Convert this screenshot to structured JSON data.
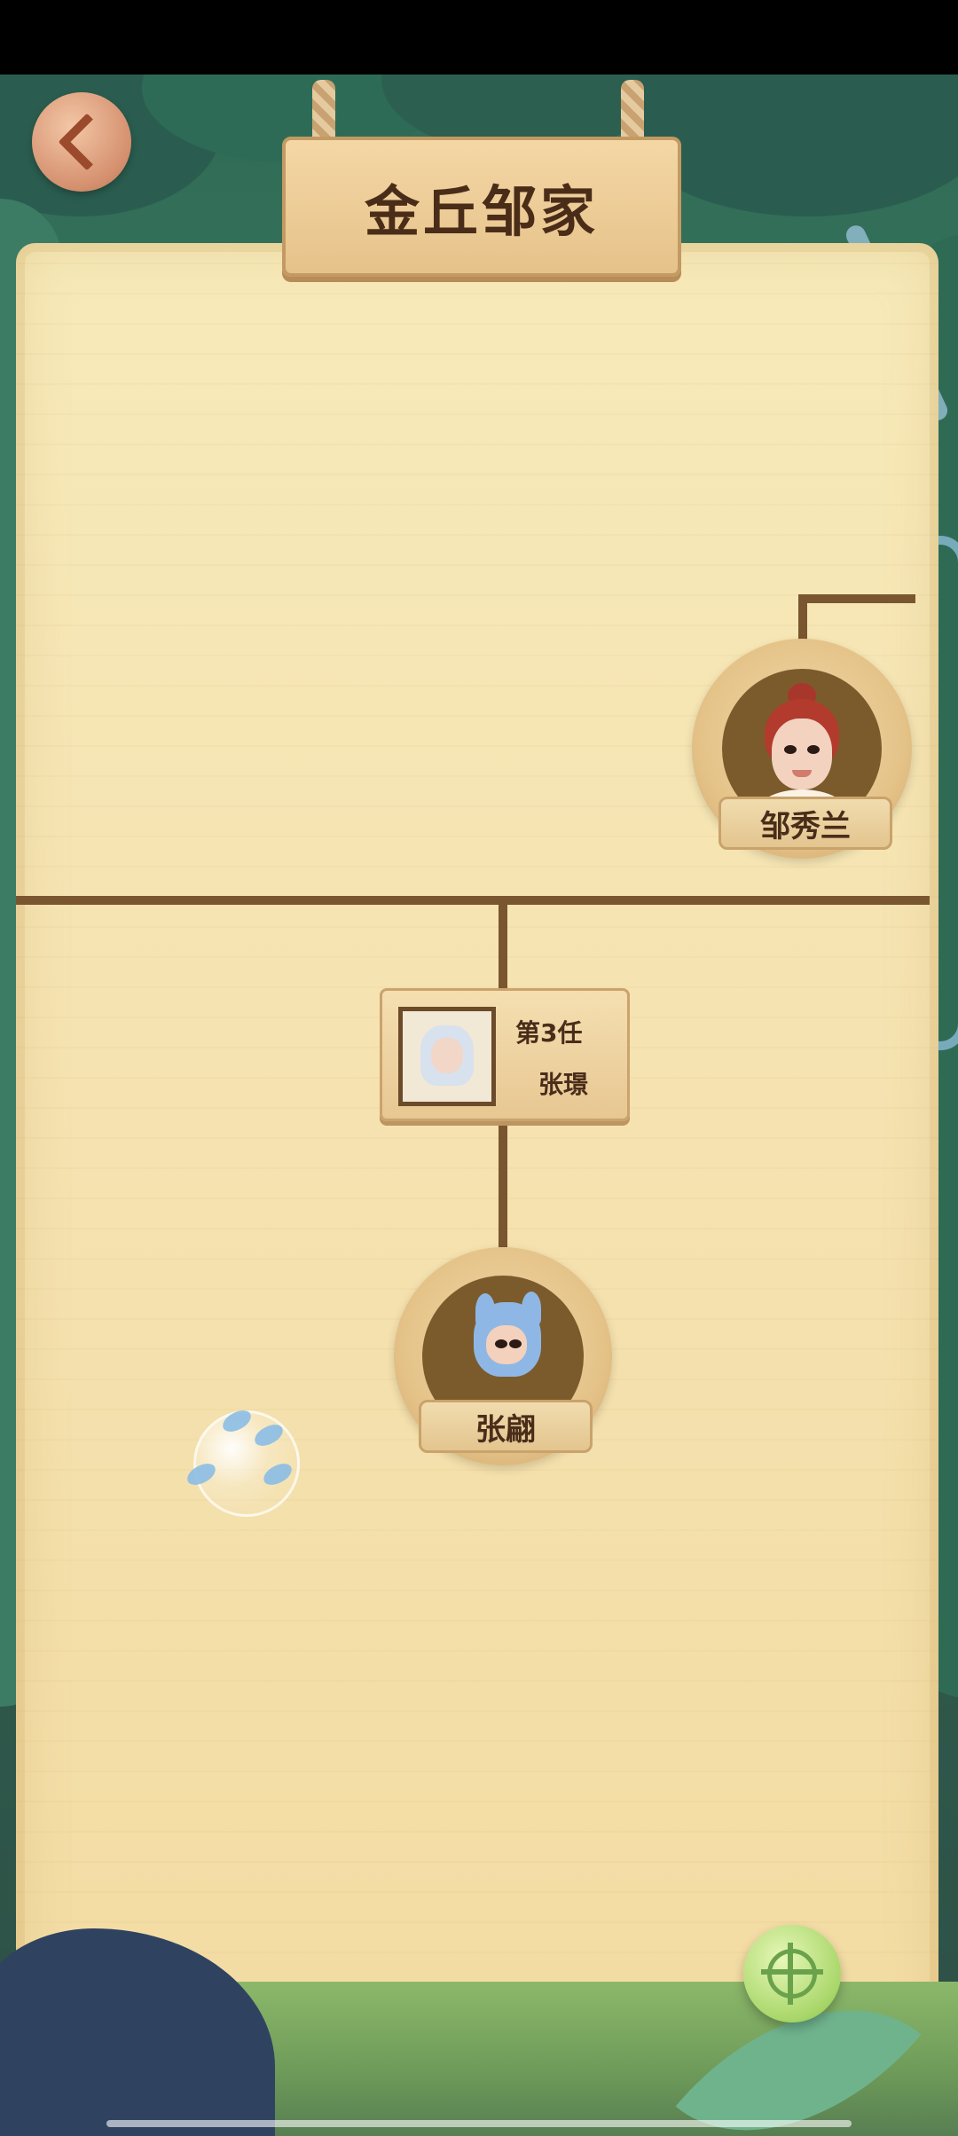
{
  "header": {
    "title": "金丘邹家"
  },
  "tree": {
    "mother": {
      "name": "邹秀兰"
    },
    "spouse": {
      "term_label": "第3任",
      "name": "张璟"
    },
    "child": {
      "name": "张翩"
    }
  },
  "icons": {
    "back": "chevron-left-icon",
    "locate": "target-icon"
  },
  "colors": {
    "line": "#7a5630",
    "wood": "#e6c28a",
    "text": "#4a2d19"
  }
}
